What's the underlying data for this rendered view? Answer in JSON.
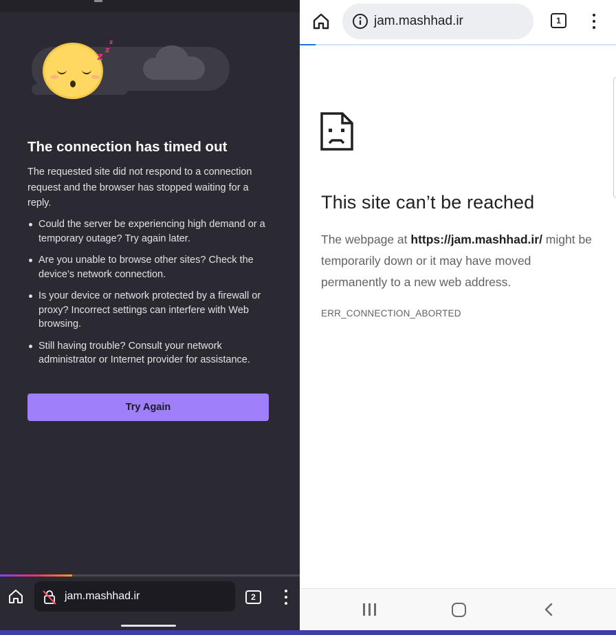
{
  "left_browser": {
    "error_title": "The connection has timed out",
    "error_intro": "The requested site did not respond to a connection request and the browser has stopped waiting for a reply.",
    "tips": [
      "Could the server be experiencing high demand or a temporary outage? Try again later.",
      "Are you unable to browse other sites? Check the device’s network connection.",
      "Is your device or network protected by a firewall or proxy? Incorrect settings can interfere with Web browsing.",
      "Still having trouble? Consult your network administrator or Internet provider for assistance."
    ],
    "try_again_label": "Try Again",
    "url": "jam.mashhad.ir",
    "tab_count": "2",
    "page_load_progress": 0.24,
    "accent_color": "#9f7ffa",
    "background_color": "#2b2a33",
    "icons": [
      "sleeping-face-icon",
      "cloud-icon",
      "home-icon",
      "insecure-lock-icon",
      "tabs-icon",
      "menu-icon"
    ]
  },
  "right_browser": {
    "url": "jam.mashhad.ir",
    "tab_count": "1",
    "error_title": "This site can’t be reached",
    "desc_before": "The webpage at ",
    "desc_url": "https://jam.mashhad.ir/",
    "desc_after": " might be temporarily down or it may have moved permanently to a new web address.",
    "error_code": "ERR_CONNECTION_ABORTED",
    "page_load_progress": 0.05,
    "accent_color": "#1a73e8",
    "icons": [
      "home-icon",
      "info-icon",
      "tabs-icon",
      "menu-icon",
      "sad-page-icon",
      "recents-icon",
      "nav-home-icon",
      "back-icon"
    ]
  }
}
